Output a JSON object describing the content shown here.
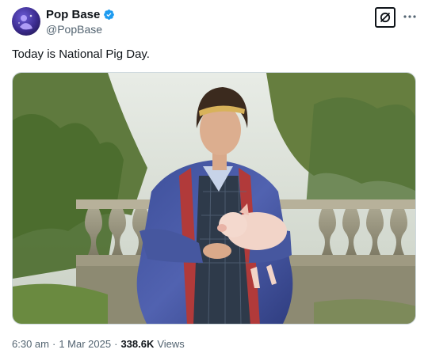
{
  "author": {
    "name": "Pop Base",
    "handle": "@PopBase",
    "verified": true
  },
  "tweet": {
    "text": "Today is National Pig Day."
  },
  "meta": {
    "time": "6:30 am",
    "date": "1 Mar 2025",
    "views_count": "338.6K",
    "views_label": "Views",
    "separator": "·"
  },
  "icons": {
    "verified": "verified-badge-icon",
    "grok": "grok-icon",
    "more": "more-options-icon"
  },
  "colors": {
    "verified_blue": "#1d9bf0",
    "text_primary": "#0f1419",
    "text_secondary": "#536471"
  }
}
